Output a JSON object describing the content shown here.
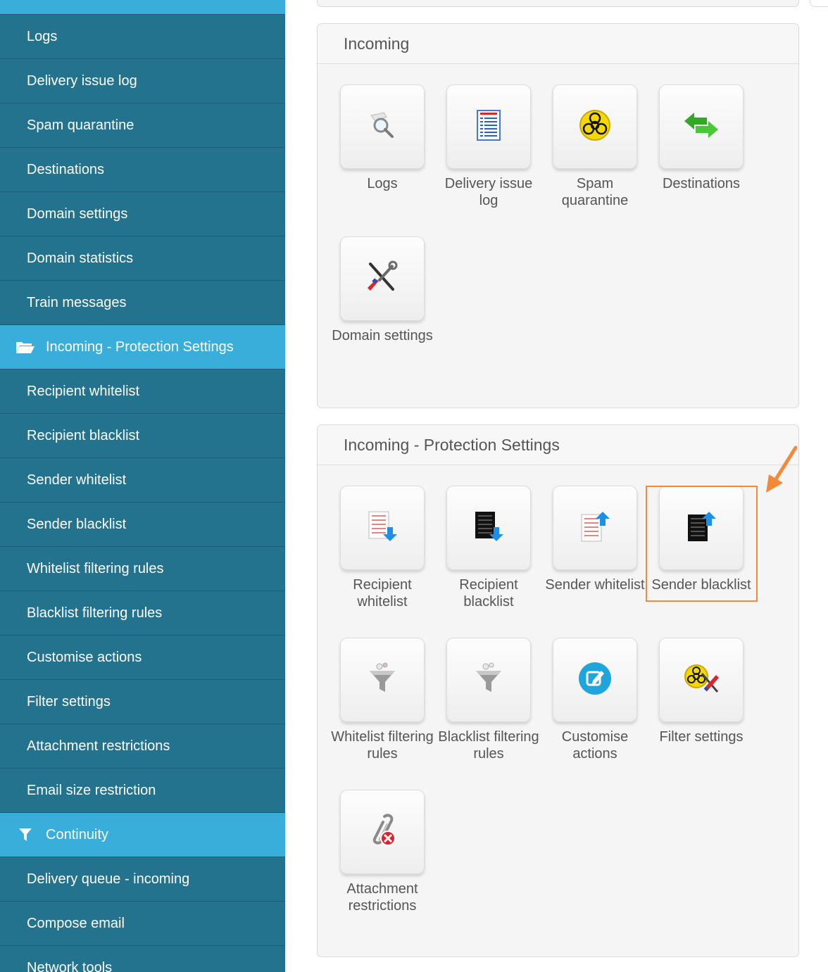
{
  "sidebar": {
    "items_a": [
      {
        "label": "Logs"
      },
      {
        "label": "Delivery issue log"
      },
      {
        "label": "Spam quarantine"
      },
      {
        "label": "Destinations"
      },
      {
        "label": "Domain settings"
      },
      {
        "label": "Domain statistics"
      },
      {
        "label": "Train messages"
      }
    ],
    "section_protection": {
      "label": "Incoming - Protection Settings",
      "icon": "folder-open-icon"
    },
    "items_b": [
      {
        "label": "Recipient whitelist"
      },
      {
        "label": "Recipient blacklist"
      },
      {
        "label": "Sender whitelist"
      },
      {
        "label": "Sender blacklist"
      },
      {
        "label": "Whitelist filtering rules"
      },
      {
        "label": "Blacklist filtering rules"
      },
      {
        "label": "Customise actions"
      },
      {
        "label": "Filter settings"
      },
      {
        "label": "Attachment restrictions"
      },
      {
        "label": "Email size restriction"
      }
    ],
    "section_continuity": {
      "label": "Continuity",
      "icon": "filter-icon"
    },
    "items_c": [
      {
        "label": "Delivery queue - incoming"
      },
      {
        "label": "Compose email"
      },
      {
        "label": "Network tools"
      }
    ]
  },
  "incoming_panel": {
    "title": "Incoming",
    "tiles": [
      {
        "label": "Logs",
        "icon": "magnifier-icon"
      },
      {
        "label": "Delivery issue log",
        "icon": "document-list-icon"
      },
      {
        "label": "Spam quarantine",
        "icon": "biohazard-icon"
      },
      {
        "label": "Destinations",
        "icon": "arrows-icon"
      },
      {
        "label": "Domain settings",
        "icon": "tools-icon"
      }
    ]
  },
  "protection_panel": {
    "title": "Incoming - Protection Settings",
    "tiles": [
      {
        "label": "Recipient whitelist",
        "icon": "whitelist-down-icon"
      },
      {
        "label": "Recipient blacklist",
        "icon": "blacklist-down-icon"
      },
      {
        "label": "Sender whitelist",
        "icon": "whitelist-up-icon"
      },
      {
        "label": "Sender blacklist",
        "icon": "blacklist-up-icon"
      },
      {
        "label": "Whitelist filtering rules",
        "icon": "funnel-icon"
      },
      {
        "label": "Blacklist filtering rules",
        "icon": "funnel-icon"
      },
      {
        "label": "Customise actions",
        "icon": "edit-icon"
      },
      {
        "label": "Filter settings",
        "icon": "biohazard-tools-icon"
      },
      {
        "label": "Attachment restrictions",
        "icon": "paperclip-blocked-icon"
      }
    ]
  },
  "colors": {
    "sidebar_bg": "#23728e",
    "sidebar_active": "#3aaedb",
    "highlight": "#f28a3a"
  }
}
